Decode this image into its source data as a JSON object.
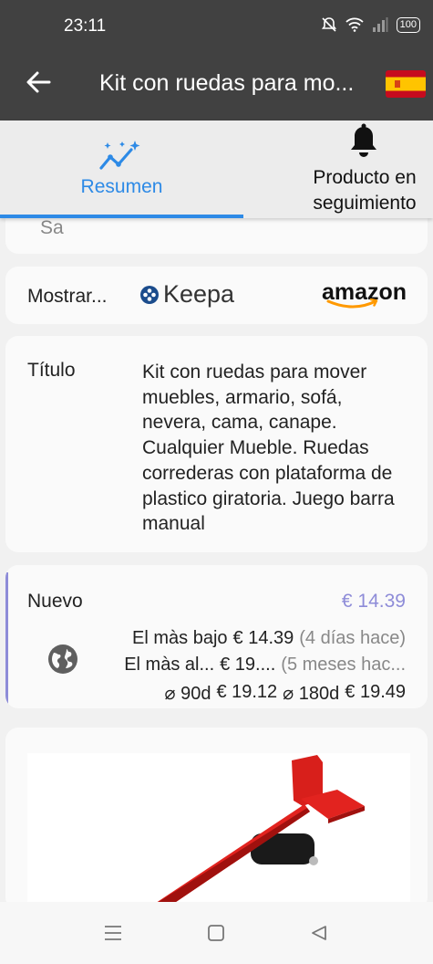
{
  "status": {
    "time": "23:11",
    "battery": "100",
    "icons": [
      "mute-bell-icon",
      "wifi-icon",
      "signal-icon",
      "battery-icon"
    ]
  },
  "appbar": {
    "title": "Kit con ruedas para mo...",
    "flag": "spain-flag-icon"
  },
  "tabs": [
    {
      "label": "Resumen",
      "icon": "chart-sparkle-icon",
      "selected": true
    },
    {
      "label": "Producto en\nseguimiento",
      "icon": "bell-icon",
      "selected": false
    }
  ],
  "top_card": {
    "cut_text": "Sa"
  },
  "show": {
    "label": "Mostrar...",
    "keepa": "Keepa",
    "amazon": "amazon"
  },
  "product": {
    "title_label": "Título",
    "title_value": "Kit con ruedas para mover muebles, armario, sofá, nevera, cama, canape. Cualquier Mueble. Ruedas correderas con plataforma de plastico giratoria. Juego barra manual"
  },
  "price": {
    "condition": "Nuevo",
    "current": "€ 14.39",
    "lowest_label": "El màs bajo",
    "lowest_value": "€ 14.39",
    "lowest_when": "(4 días hace)",
    "highest_label": "El màs al...",
    "highest_value": "€ 19....",
    "highest_when": "(5 meses hac...",
    "avg90_label": "⌀ 90d",
    "avg90_value": "€ 19.12",
    "avg180_label": "⌀ 180d",
    "avg180_value": "€ 19.49"
  },
  "colors": {
    "accent": "#2d8ae6",
    "price_accent": "#8e8cd8",
    "appbar": "#414141",
    "product_red": "#e2231f"
  }
}
